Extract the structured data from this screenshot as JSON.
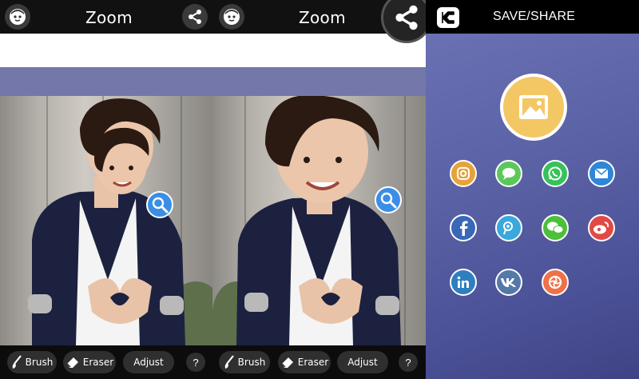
{
  "panels": {
    "zoom_left": {
      "title": "Zoom",
      "tools": {
        "brush": "Brush",
        "eraser": "Eraser",
        "adjust": "Adjust",
        "help": "?"
      }
    },
    "zoom_right": {
      "title": "Zoom",
      "tools": {
        "brush": "Brush",
        "eraser": "Eraser",
        "adjust": "Adjust",
        "help": "?"
      }
    },
    "share": {
      "title": "SAVE/SHARE",
      "icons": [
        {
          "name": "instagram-icon",
          "color": "#e8a23a"
        },
        {
          "name": "message-icon",
          "color": "#5cc85a"
        },
        {
          "name": "whatsapp-icon",
          "color": "#37c15a"
        },
        {
          "name": "mail-icon",
          "color": "#2f86d6"
        },
        {
          "name": "facebook-icon",
          "color": "#3a67b8"
        },
        {
          "name": "periscope-icon",
          "color": "#3aa8dc"
        },
        {
          "name": "wechat-icon",
          "color": "#4dbf3a"
        },
        {
          "name": "weibo-icon",
          "color": "#e04a45"
        },
        {
          "name": "linkedin-icon",
          "color": "#2f7fbf"
        },
        {
          "name": "vk-icon",
          "color": "#5479a8"
        },
        {
          "name": "aperture-icon",
          "color": "#ef7147"
        }
      ]
    }
  },
  "colors": {
    "topbar": "#111111",
    "gallery": "#f4c765",
    "zoom_lens": "#3a8ee6"
  }
}
